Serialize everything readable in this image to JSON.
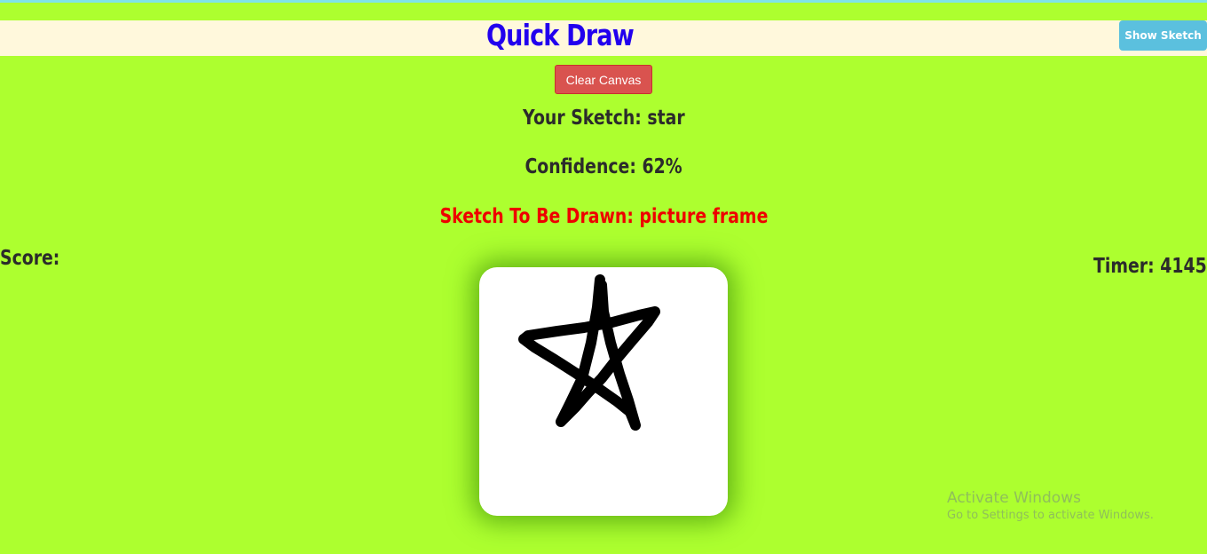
{
  "header": {
    "title": "Quick Draw",
    "show_sketch_label": "Show Sketch"
  },
  "controls": {
    "clear_label": "Clear Canvas"
  },
  "prediction": {
    "your_sketch": "Your Sketch: star",
    "confidence": "Confidence: 62%",
    "target": "Sketch To Be Drawn: picture frame"
  },
  "score": {
    "label": "Score:"
  },
  "timer": {
    "label": "Timer: 4145"
  },
  "canvas": {
    "drawing": "star-drawing"
  },
  "watermark": {
    "title": "Activate Windows",
    "subtitle": "Go to Settings to activate Windows."
  },
  "colors": {
    "background": "#adff2f",
    "header_bar": "#fff8dc",
    "title": "#2200ee",
    "clear_button": "#d9534f",
    "show_sketch_button": "#5bc0de",
    "target_text": "#ee0000"
  }
}
